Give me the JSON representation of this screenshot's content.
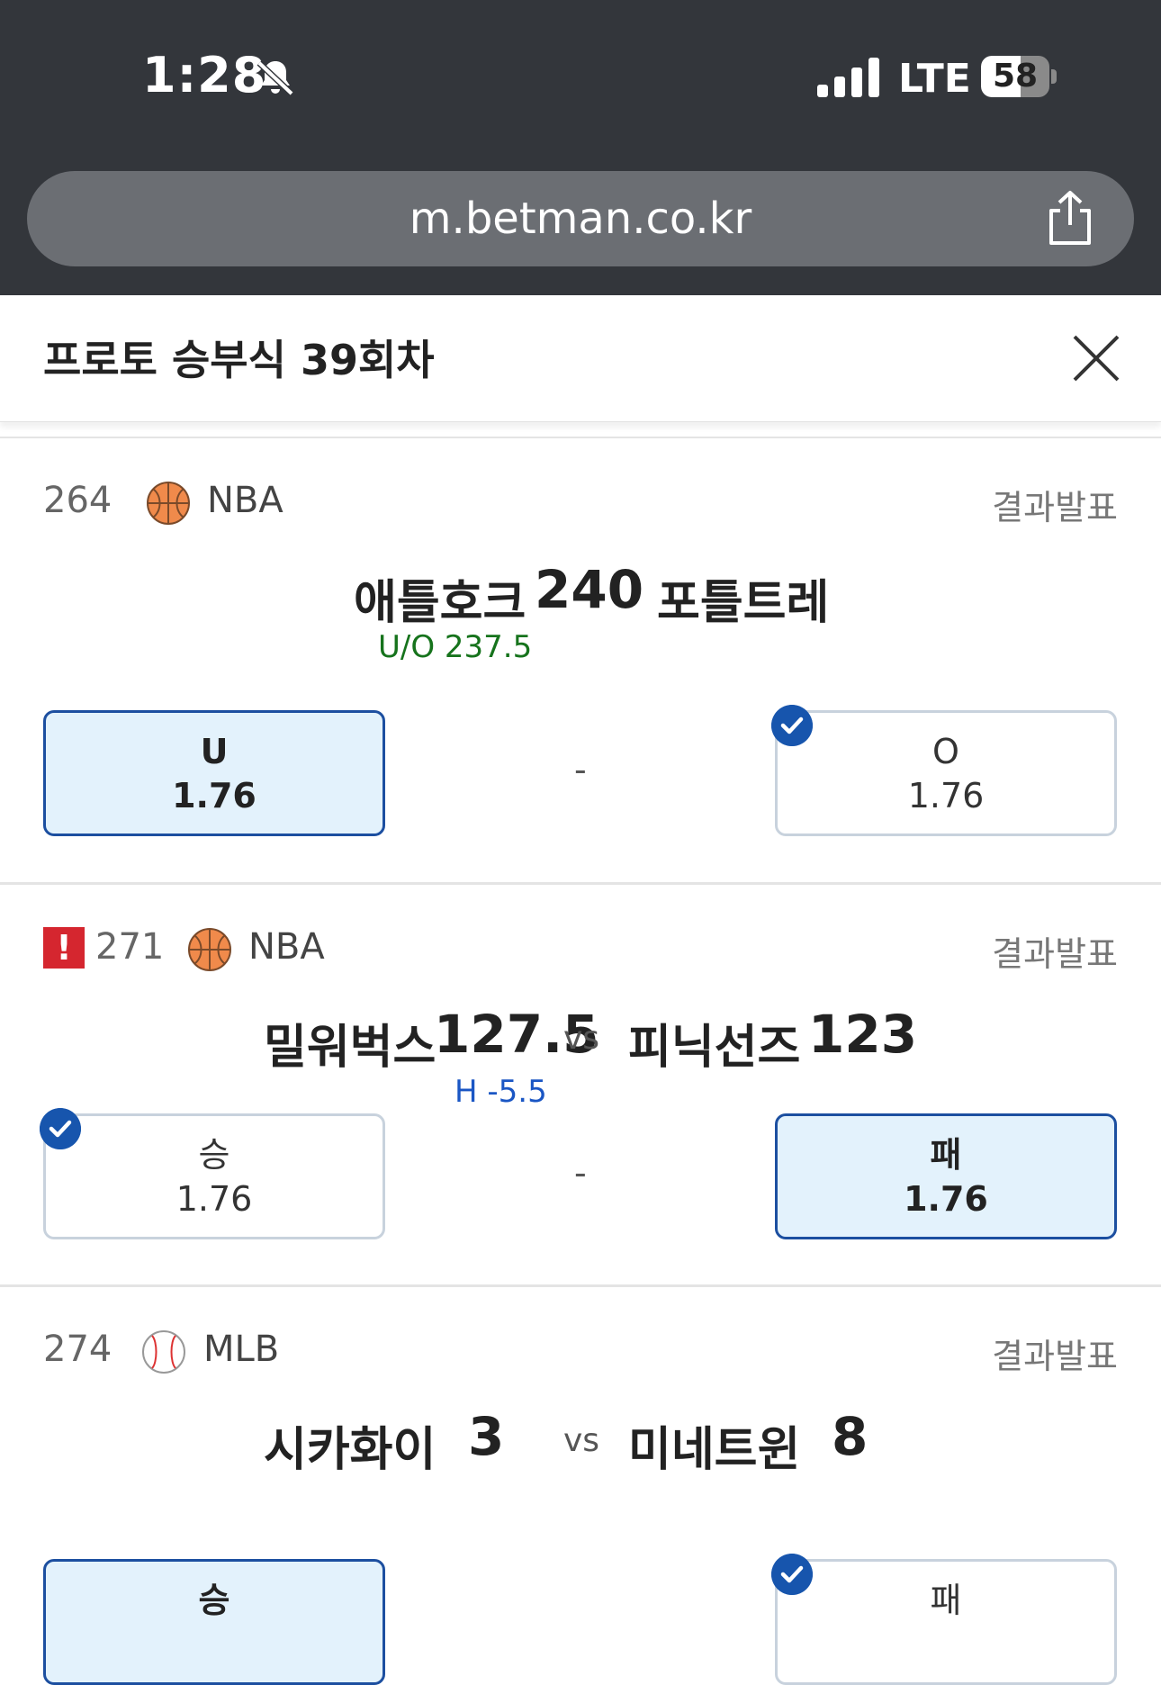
{
  "status_bar": {
    "time": "1:28",
    "carrier": "LTE",
    "battery": "58",
    "battery_level": 0.58
  },
  "browser": {
    "url": "m.betman.co.kr"
  },
  "header": {
    "title": "프로토 승부식 39회차"
  },
  "games": [
    {
      "number": "264",
      "league": "NBA",
      "sport_icon": "basketball-icon",
      "result_label": "결과발표",
      "home": "애틀호크",
      "total_score": "240",
      "away": "포틀트레",
      "line": "U/O 237.5",
      "options": [
        {
          "label": "U",
          "odds": "1.76",
          "state": "selected"
        },
        {
          "label": "-"
        },
        {
          "label": "O",
          "odds": "1.76",
          "state": "checked"
        }
      ]
    },
    {
      "number": "271",
      "league": "NBA",
      "sport_icon": "basketball-icon",
      "result_label": "결과발표",
      "warning": "!",
      "home": "밀워벅스",
      "home_score": "127.5",
      "vs": "vs",
      "away": "피닉선즈",
      "away_score": "123",
      "line": "H -5.5",
      "options": [
        {
          "label": "승",
          "odds": "1.76",
          "state": "checked"
        },
        {
          "label": "-"
        },
        {
          "label": "패",
          "odds": "1.76",
          "state": "selected"
        }
      ]
    },
    {
      "number": "274",
      "league": "MLB",
      "sport_icon": "baseball-icon",
      "result_label": "결과발표",
      "home": "시카화이",
      "home_score": "3",
      "vs": "vs",
      "away": "미네트윈",
      "away_score": "8",
      "options": [
        {
          "label": "승",
          "state": "selected"
        },
        {
          "label": "패",
          "state": "checked"
        }
      ]
    }
  ],
  "colors": {
    "selected_border": "#1c4fa0",
    "selected_bg": "#e3f2fc",
    "check_badge": "#1755ad",
    "ou_line": "#16731c",
    "handicap_line": "#1a56c4",
    "warning": "#d5262f"
  }
}
